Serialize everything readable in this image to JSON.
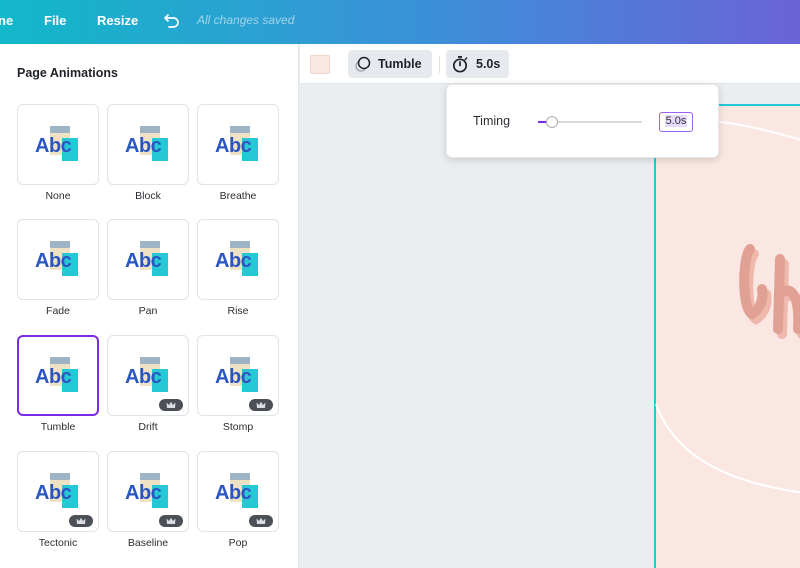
{
  "topbar": {
    "home_partial": "ne",
    "file": "File",
    "resize": "Resize",
    "status": "All changes saved"
  },
  "panel": {
    "title": "Page Animations",
    "animations": [
      {
        "label": "None",
        "premium": false,
        "selected": false
      },
      {
        "label": "Block",
        "premium": false,
        "selected": false
      },
      {
        "label": "Breathe",
        "premium": false,
        "selected": false
      },
      {
        "label": "Fade",
        "premium": false,
        "selected": false
      },
      {
        "label": "Pan",
        "premium": false,
        "selected": false
      },
      {
        "label": "Rise",
        "premium": false,
        "selected": false
      },
      {
        "label": "Tumble",
        "premium": false,
        "selected": true
      },
      {
        "label": "Drift",
        "premium": true,
        "selected": false
      },
      {
        "label": "Stomp",
        "premium": true,
        "selected": false
      },
      {
        "label": "Tectonic",
        "premium": true,
        "selected": false
      },
      {
        "label": "Baseline",
        "premium": true,
        "selected": false
      },
      {
        "label": "Pop",
        "premium": true,
        "selected": false
      }
    ],
    "thumb_text": "Abc"
  },
  "toolbar": {
    "background_color": "#fbe7e1",
    "animation_label": "Tumble",
    "duration_label": "5.0s"
  },
  "timing_popover": {
    "label": "Timing",
    "value": "5.0s",
    "slider_fraction": 0.13
  },
  "colors": {
    "accent": "#7d2ae8",
    "teal": "#27c8d6",
    "page_bg": "#fbe7e1"
  }
}
